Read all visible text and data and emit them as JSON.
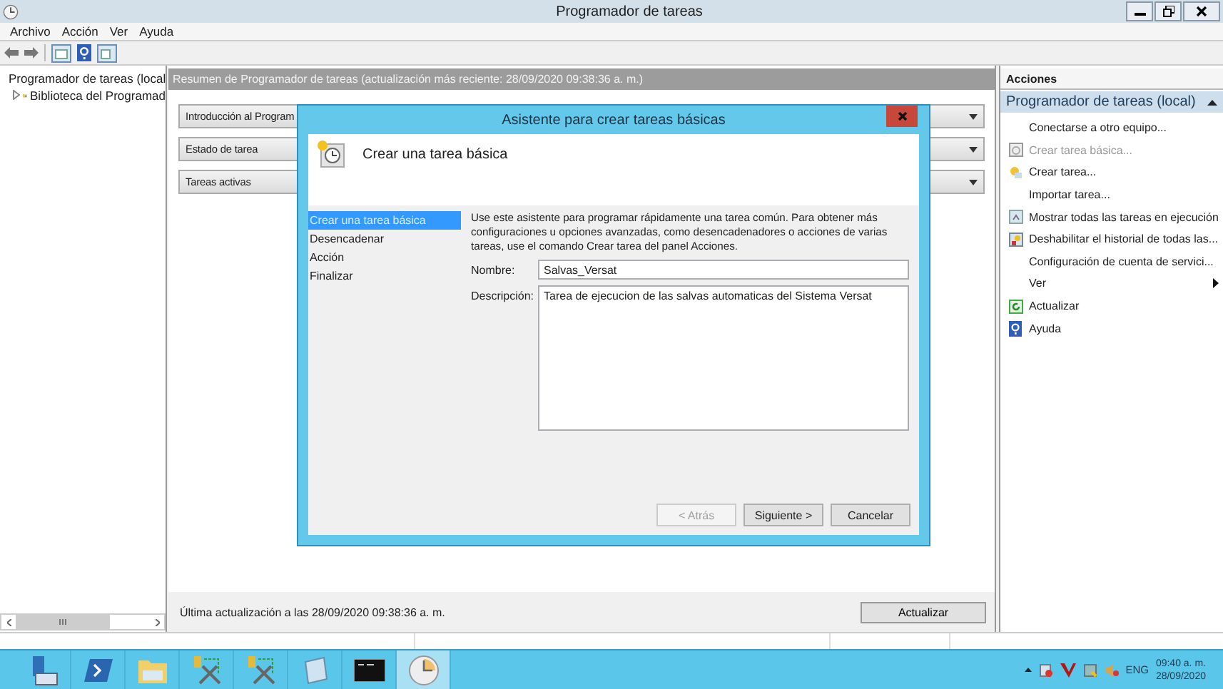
{
  "window": {
    "title": "Programador de tareas"
  },
  "menu": [
    "Archivo",
    "Acción",
    "Ver",
    "Ayuda"
  ],
  "tree": [
    {
      "label": "Programador de tareas (local",
      "children": [
        {
          "label": "Biblioteca del Programad",
          "expanded": false
        }
      ]
    }
  ],
  "summary": {
    "header": "Resumen de Programador de tareas (actualización más reciente: 28/09/2020 09:38:36 a. m.)",
    "sections": [
      {
        "label": "Introducción al Program"
      },
      {
        "label": "Estado de tarea"
      },
      {
        "label": "Tareas activas"
      }
    ],
    "footer": "Última actualización a las 28/09/2020 09:38:36 a. m.",
    "refresh_button": "Actualizar"
  },
  "actions": {
    "title": "Acciones",
    "group": {
      "title": "Programador de tareas (local)",
      "expanded": true
    },
    "items": [
      {
        "label": "Conectarse a otro equipo...",
        "kind": "action",
        "disabled": false
      },
      {
        "label": "Crear tarea básica...",
        "kind": "action",
        "disabled": true
      },
      {
        "label": "Crear tarea...",
        "kind": "action",
        "disabled": false
      },
      {
        "label": "Importar tarea...",
        "kind": "action",
        "disabled": false
      },
      {
        "label": "Mostrar todas las tareas en ejecución",
        "kind": "action",
        "disabled": false
      },
      {
        "label": "Deshabilitar el historial de todas las...",
        "kind": "action",
        "disabled": false
      },
      {
        "label": "Configuración de cuenta de servici...",
        "kind": "action",
        "disabled": false
      },
      {
        "label": "Ver",
        "kind": "submenu",
        "disabled": false
      },
      {
        "label": "Actualizar",
        "kind": "action",
        "disabled": false
      },
      {
        "label": "Ayuda",
        "kind": "action",
        "disabled": false
      }
    ]
  },
  "dialog": {
    "title": "Asistente para crear tareas básicas",
    "heading": "Crear una tarea básica",
    "steps": [
      {
        "label": "Crear una tarea básica",
        "selected": true
      },
      {
        "label": "Desencadenar",
        "selected": false
      },
      {
        "label": "Acción",
        "selected": false
      },
      {
        "label": "Finalizar",
        "selected": false
      }
    ],
    "intro": "Use este asistente para programar rápidamente una tarea común. Para obtener más configuraciones u opciones avanzadas, como desencadenadores o acciones de varias tareas, use el comando Crear tarea del panel Acciones.",
    "fields": [
      {
        "label": "Nombre:",
        "value": "Salvas_Versat",
        "kind": "line"
      },
      {
        "label": "Descripción:",
        "value": "Tarea de ejecucion de las salvas automaticas del Sistema Versat",
        "kind": "area"
      }
    ],
    "buttons": [
      {
        "label": "< Atrás",
        "disabled": true
      },
      {
        "label": "Siguiente >",
        "disabled": false
      },
      {
        "label": "Cancelar",
        "disabled": false
      }
    ]
  },
  "taskbar": {
    "apps": [
      {
        "active": false
      },
      {
        "active": false
      },
      {
        "active": false
      },
      {
        "active": false
      },
      {
        "active": false
      },
      {
        "active": false
      },
      {
        "active": false
      },
      {
        "active": true
      }
    ]
  },
  "tray": {
    "language": "ENG",
    "time": "09:40 a. m.",
    "date": "28/09/2020"
  }
}
